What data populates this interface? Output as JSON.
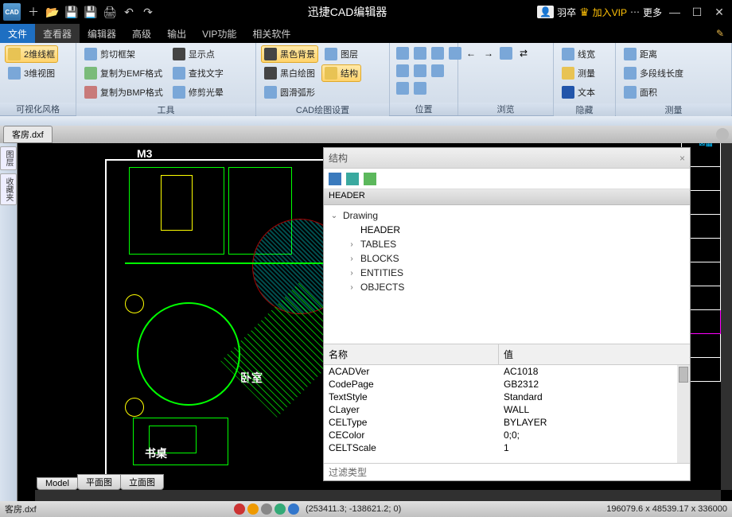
{
  "title": "迅捷CAD编辑器",
  "user_name": "羽卒",
  "vip_label": "加入VIP",
  "more_label": "更多",
  "menu": {
    "file": "文件",
    "viewer": "查看器",
    "editor": "编辑器",
    "advanced": "高级",
    "output": "输出",
    "vip": "VIP功能",
    "related": "相关软件"
  },
  "ribbon": {
    "g1": {
      "label": "可视化风格",
      "wf2d": "2维线框",
      "view3d": "3维视图"
    },
    "g2": {
      "label": "工具",
      "clipframe": "剪切框架",
      "copyEmf": "复制为EMF格式",
      "copyBmp": "复制为BMP格式",
      "showpts": "显示点",
      "findtext": "查找文字",
      "trimhalo": "修剪光晕"
    },
    "g3": {
      "label": "CAD绘图设置",
      "blackbg": "黑色背景",
      "bwdraw": "黑白绘图",
      "smootharc": "圆滑弧形",
      "layer": "图层",
      "structure": "结构"
    },
    "g4": {
      "label": "位置"
    },
    "g5": {
      "label": "浏览"
    },
    "g6": {
      "label": "隐藏",
      "linewidth": "线宽",
      "measure": "测量",
      "text": "文本"
    },
    "g7": {
      "label": "测量",
      "distance": "距离",
      "polylen": "多段线长度",
      "area": "面积"
    }
  },
  "file_tab": "客房.dxf",
  "sidebar": {
    "tab1": "图层",
    "tab2": "收藏夹"
  },
  "cad_labels": {
    "m3": "M3",
    "bedroom": "卧室",
    "desk": "书桌"
  },
  "panel": {
    "title": "结构",
    "header": "HEADER",
    "tree": {
      "root": "Drawing",
      "n1": "HEADER",
      "n2": "TABLES",
      "n3": "BLOCKS",
      "n4": "ENTITIES",
      "n5": "OBJECTS"
    },
    "grid": {
      "col1": "名称",
      "col2": "值",
      "rows": [
        {
          "k": "ACADVer",
          "v": "AC1018"
        },
        {
          "k": "CodePage",
          "v": "GB2312"
        },
        {
          "k": "TextStyle",
          "v": "Standard"
        },
        {
          "k": "CLayer",
          "v": "WALL"
        },
        {
          "k": "CELType",
          "v": "BYLAYER"
        },
        {
          "k": "CEColor",
          "v": "0;0;"
        },
        {
          "k": "CELTScale",
          "v": "1"
        }
      ]
    },
    "filter": "过滤类型"
  },
  "layout_tabs": {
    "model": "Model",
    "plan": "平面图",
    "elev": "立面图"
  },
  "status": {
    "file": "客房.dxf",
    "coords": "(253411.3; -138621.2; 0)",
    "dims": "196079.6 x 48539.17 x 336000"
  }
}
